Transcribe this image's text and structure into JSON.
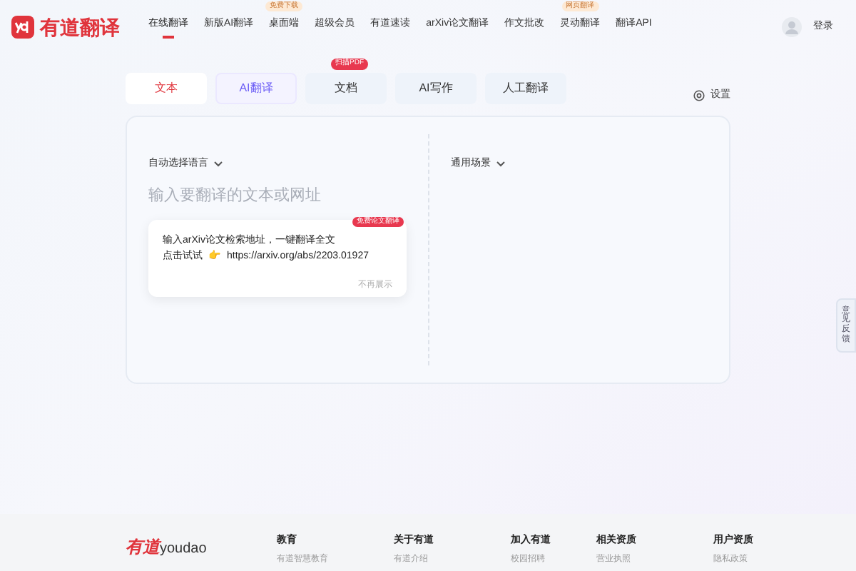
{
  "header": {
    "logo_text": "有道翻译",
    "nav": [
      {
        "label": "在线翻译",
        "selected": true
      },
      {
        "label": "新版AI翻译",
        "selected": false
      },
      {
        "label": "桌面端",
        "selected": false,
        "badge": "免费下载"
      },
      {
        "label": "超级会员",
        "selected": false
      },
      {
        "label": "有道速读",
        "selected": false
      },
      {
        "label": "arXiv论文翻译",
        "selected": false
      },
      {
        "label": "作文批改",
        "selected": false
      },
      {
        "label": "灵动翻译",
        "selected": false,
        "badge": "网页翻译"
      },
      {
        "label": "翻译API",
        "selected": false
      }
    ],
    "login": "登录"
  },
  "mode_tabs": [
    {
      "label": "文本",
      "selected": true,
      "kind": "plain"
    },
    {
      "label": "AI翻译",
      "selected": false,
      "kind": "ai"
    },
    {
      "label": "文档",
      "selected": false,
      "kind": "plain",
      "badge": "扫描PDF"
    },
    {
      "label": "AI写作",
      "selected": false,
      "kind": "plain"
    },
    {
      "label": "人工翻译",
      "selected": false,
      "kind": "plain"
    }
  ],
  "settings": "设置",
  "source": {
    "language": "自动选择语言",
    "placeholder": "输入要翻译的文本或网址"
  },
  "target": {
    "scene": "通用场景"
  },
  "tip": {
    "badge": "免费论文翻译",
    "line_1": "输入arXiv论文检索地址，一键翻译全文",
    "line_2_prefix": "点击试试",
    "emoji": "👉",
    "link": "https://arxiv.org/abs/2203.01927",
    "dismiss": "不再展示"
  },
  "feedback": "意见反馈",
  "footer": {
    "logo_text": "有道",
    "logo_word": "youdao",
    "columns": [
      {
        "heading": "教育",
        "link": "有道智慧教育"
      },
      {
        "heading": "关于有道",
        "link": "有道介绍"
      },
      {
        "heading": "加入有道",
        "link": "校园招聘"
      },
      {
        "heading": "相关资质",
        "link": "营业执照"
      },
      {
        "heading": "用户资质",
        "link": "隐私政策"
      }
    ]
  }
}
